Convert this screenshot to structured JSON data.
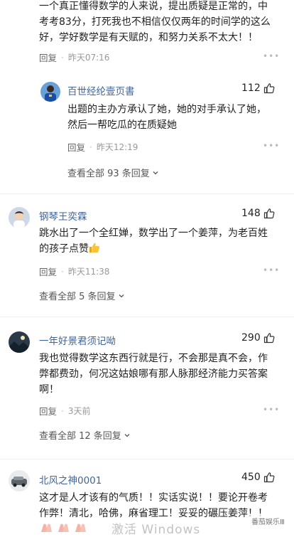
{
  "comments_top": {
    "text": "一个真正懂得数学的人来说，提出质疑是正常的，中考考83分，打死我也不相信仅仅两年的时间学的这么好，学好数学是有天赋的，和努力关系不太大！！",
    "reply_label": "回复",
    "time": "昨天07:16"
  },
  "nested_reply": {
    "username": "百世经纶壹页書",
    "likes": "112",
    "text": "出题的主办方承认了她，她的对手承认了她，然后一帮吃瓜的在质疑她",
    "reply_label": "回复",
    "time": "昨天12:19",
    "view_all": "查看全部 93 条回复"
  },
  "comment2": {
    "username": "钢琴王奕霖",
    "likes": "148",
    "text": "跳水出了一个全红婵，数学出了一个姜萍，为老百姓的孩子点赞",
    "reply_label": "回复",
    "time": "昨天11:38",
    "view_all": "查看全部 5 条回复"
  },
  "comment3": {
    "username": "一年好景君须记呦",
    "likes": "290",
    "text": "我也觉得数学这东西行就是行，不会那是真不会，作弊都费劲，何况这姑娘哪有那人脉那经济能力买答案啊！",
    "reply_label": "回复",
    "time": "3天前",
    "view_all": "查看全部 12 条回复"
  },
  "comment4": {
    "username": "北风之神0001",
    "likes": "450",
    "text": "这才是人才该有的气质！！实话实说！！要论开卷考作弊！清北，哈佛，麻省理工！妥妥的碾压姜萍！！"
  },
  "overlay": {
    "windows_watermark": "激活 Windows",
    "channel_watermark": "番茄娱乐Ⅲ"
  },
  "colors": {
    "username": "#406599",
    "meta": "#999999",
    "text": "#222222"
  },
  "icons": {
    "like": "thumbs-up-icon",
    "more": "more-dots-icon",
    "expand": "chevron-down-icon",
    "emoji_like": "thumbs-up-emoji",
    "emoji_clap": "clapping-hands-emoji"
  }
}
